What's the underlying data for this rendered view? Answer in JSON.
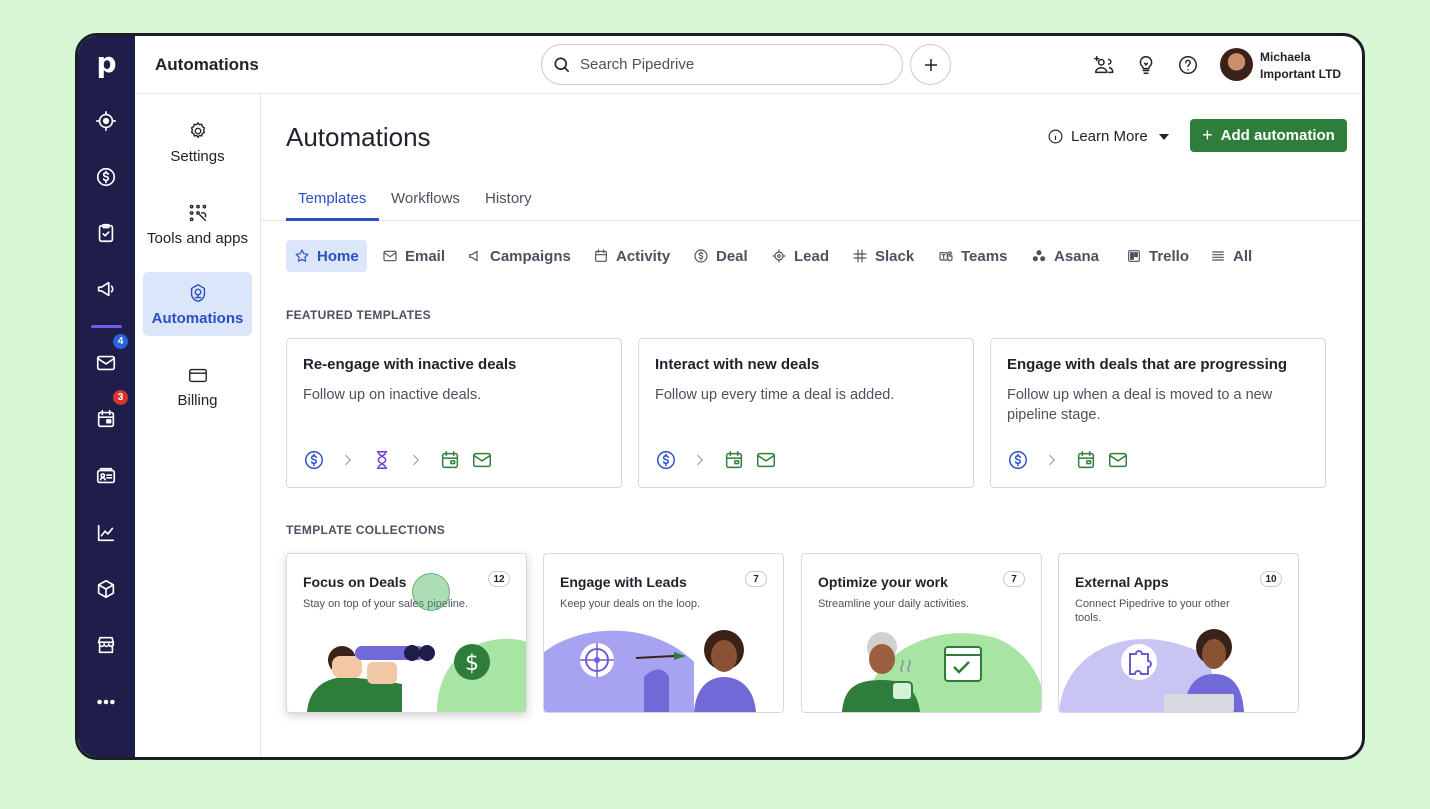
{
  "rail": {
    "logo": "p",
    "badges": {
      "mail": "4",
      "calendar": "3"
    }
  },
  "topbar": {
    "title": "Automations",
    "search_placeholder": "Search Pipedrive",
    "user_name": "Michaela",
    "user_company": "Important LTD"
  },
  "sidebar": {
    "items": [
      {
        "label": "Settings",
        "icon": "gear-icon"
      },
      {
        "label": "Tools and apps",
        "icon": "tools-icon"
      },
      {
        "label": "Automations",
        "icon": "automations-icon",
        "active": true
      },
      {
        "label": "Billing",
        "icon": "card-icon"
      }
    ]
  },
  "page": {
    "title": "Automations",
    "learn_more": "Learn More",
    "add_button": "Add automation",
    "tabs": [
      "Templates",
      "Workflows",
      "History"
    ],
    "chips": [
      "Home",
      "Email",
      "Campaigns",
      "Activity",
      "Deal",
      "Lead",
      "Slack",
      "Teams",
      "Asana",
      "Trello",
      "All"
    ]
  },
  "featured": {
    "label": "FEATURED TEMPLATES",
    "cards": [
      {
        "title": "Re-engage with inactive deals",
        "desc": "Follow up on inactive deals."
      },
      {
        "title": "Interact with new deals",
        "desc": "Follow up every time a deal is added."
      },
      {
        "title": "Engage with deals that are progressing",
        "desc": "Follow up when a deal is moved to a new pipeline stage."
      }
    ]
  },
  "collections": {
    "label": "TEMPLATE COLLECTIONS",
    "cards": [
      {
        "title": "Focus on Deals",
        "desc": "Stay on top of your sales pipeline.",
        "count": "12"
      },
      {
        "title": "Engage with Leads",
        "desc": "Keep your deals on the loop.",
        "count": "7"
      },
      {
        "title": "Optimize your work",
        "desc": "Streamline your daily activities.",
        "count": "7"
      },
      {
        "title": "External Apps",
        "desc": "Connect Pipedrive to your other tools.",
        "count": "10"
      }
    ]
  },
  "colors": {
    "rail": "#1f1e4a",
    "accent": "#2a4fc2",
    "primary_button": "#2e7d3a",
    "background": "#d7f7d4"
  }
}
